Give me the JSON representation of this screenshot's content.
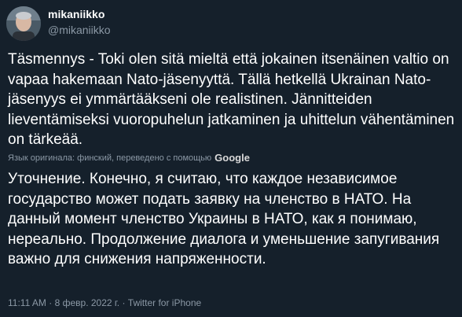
{
  "author": {
    "display_name": "mikaniikko",
    "handle": "@mikaniikko"
  },
  "tweet": {
    "text_fi": "Täsmennys - Toki olen sitä mieltä että jokainen itsenäinen valtio on vapaa hakemaan Nato-jäsenyyttä. Tällä hetkellä Ukrainan Nato-jäsenyys ei ymmärtääkseni ole realistinen. Jännitteiden lieventämiseksi vuoropuhelun jatkaminen ja uhittelun vähentäminen on tärkeää.",
    "translation_note": "Язык оригинала: финский, переведено с помощью",
    "translation_provider": "Google",
    "text_ru": "Уточнение. Конечно, я считаю, что каждое независимое государство может подать заявку на членство в НАТО. На данный момент членство Украины в НАТО, как я понимаю, нереально. Продолжение диалога и уменьшение запугивания важно для снижения напряженности.",
    "timestamp": "11:11 AM · 8 февр. 2022 г. · Twitter for iPhone"
  },
  "colors": {
    "background": "#15202b",
    "primary_text": "#ffffff",
    "secondary_text": "#8b98a5"
  }
}
